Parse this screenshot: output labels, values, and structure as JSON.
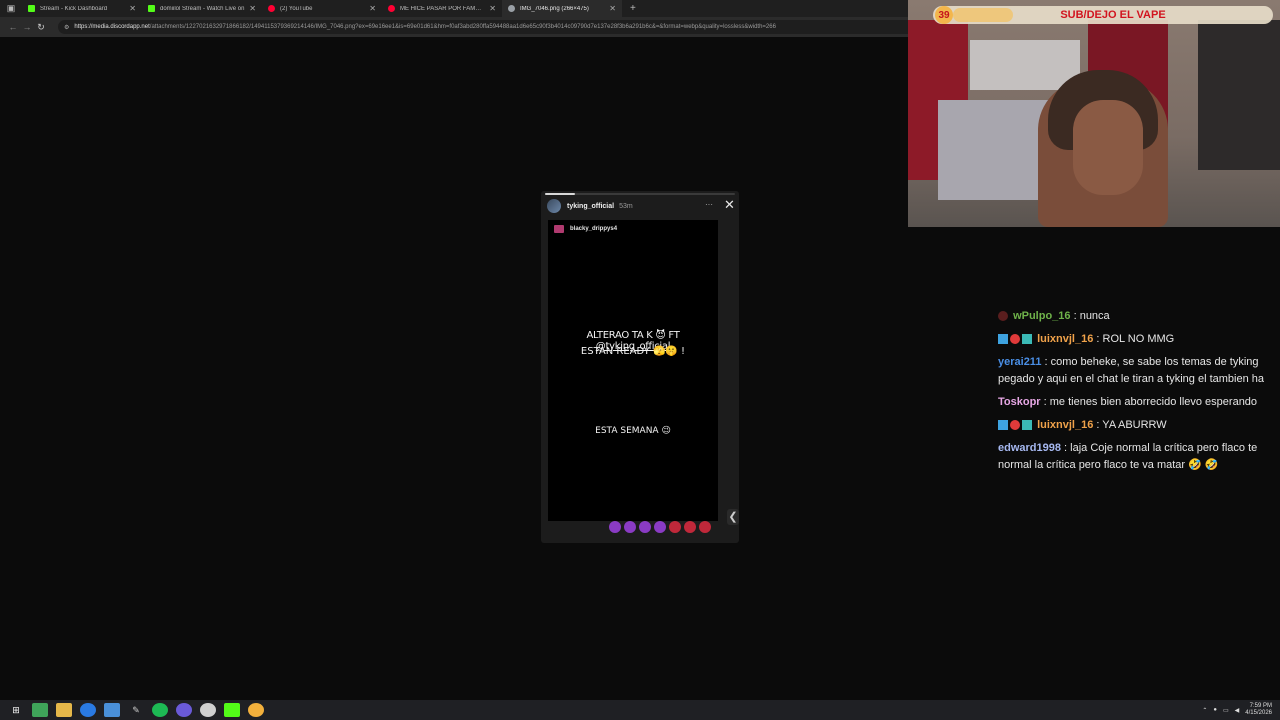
{
  "browser": {
    "tabs": [
      {
        "label": "Stream - Kick Dashboard",
        "fav_color": "#53fc18",
        "active": false
      },
      {
        "label": "domiilol Stream - Watch Live on",
        "fav_color": "#53fc18",
        "active": false
      },
      {
        "label": "(2) YouTube",
        "fav_color": "#ff0033",
        "active": false
      },
      {
        "label": "ME HICE PASAR POR FAMOSOS",
        "fav_color": "#ff0033",
        "active": false
      },
      {
        "label": "IMG_7046.png (266×475)",
        "fav_color": "#9aa0a6",
        "active": true
      }
    ],
    "new_tab": "+",
    "url_host": "https://media.discordapp.net",
    "url_path": "/attachments/1227021632971866182/1494115379369214146/IMG_7046.png?ex=69e16ee1&is=69e01d61&hm=f0af3abd280ffa594488aa1d6e65c90f3b4014c09790d7e137e28f3b6a291b6c&=&format=webp&quality=lossless&width=266"
  },
  "story": {
    "username": "tyking_official",
    "age": "53m",
    "more": "···",
    "close": "✕",
    "mention": "blacky_drippys4",
    "line1_pre": "ALTERAO TA K 😈 FT ",
    "line1_tag": "@tyking_official",
    "line2": "ESTAN READY 🫣🤫 !",
    "line3": "ESTA SEMANA 😉",
    "next": "❮"
  },
  "cam": {
    "count": "39",
    "goal": "SUB/DEJO EL VAPE"
  },
  "chat": [
    {
      "user": "wPulpo_16",
      "text": " : nunca"
    },
    {
      "user": "luixnvjl_16",
      "text": " : ROL NO MMG"
    },
    {
      "user": "yerai211",
      "text": " : como beheke, se sabe los temas de tyking pegado y aqui en el chat le tiran a tyking el tambien ha"
    },
    {
      "user": "Toskopr",
      "text": " : me tienes bien aborrecido llevo esperando"
    },
    {
      "user": "luixnvjl_16",
      "text": " : YA ABURRW"
    },
    {
      "user": "edward1998",
      "text": " : laja Coje normal la crítica pero flaco te normal la crítica pero flaco te va matar 🤣 🤣"
    }
  ],
  "taskbar": {
    "time": "7:59 PM",
    "date": "4/15/2026"
  }
}
